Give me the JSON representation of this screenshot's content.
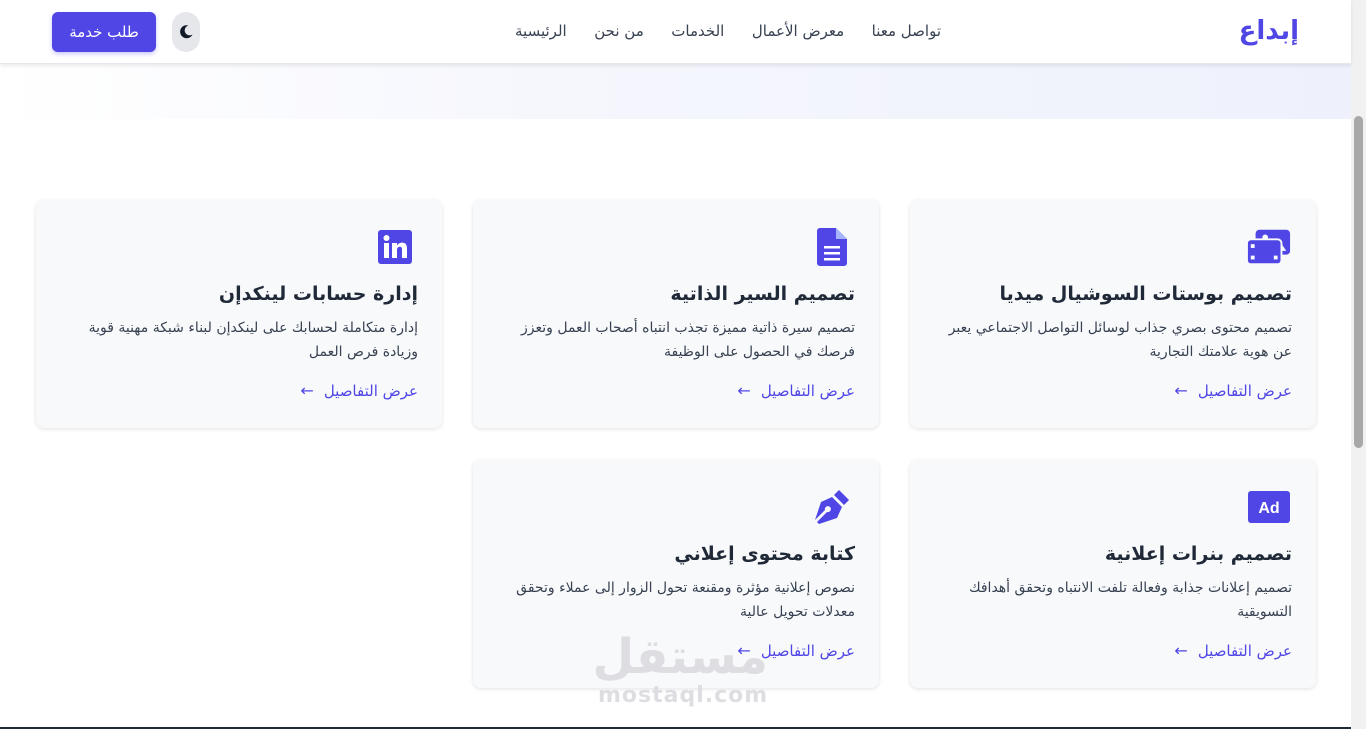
{
  "header": {
    "logo": "إبداع",
    "nav": [
      {
        "label": "الرئيسية"
      },
      {
        "label": "من نحن"
      },
      {
        "label": "الخدمات"
      },
      {
        "label": "معرض الأعمال"
      },
      {
        "label": "تواصل معنا"
      }
    ],
    "theme_toggle_icon": "moon-icon",
    "cta_label": "طلب خدمة"
  },
  "services": [
    {
      "icon": "photo-film-icon",
      "title": "تصميم بوستات السوشيال ميديا",
      "description": "تصميم محتوى بصري جذاب لوسائل التواصل الاجتماعي يعبر عن هوية علامتك التجارية",
      "link": "عرض التفاصيل"
    },
    {
      "icon": "file-icon",
      "title": "تصميم السير الذاتية",
      "description": "تصميم سيرة ذاتية مميزة تجذب انتباه أصحاب العمل وتعزز فرصك في الحصول على الوظيفة",
      "link": "عرض التفاصيل"
    },
    {
      "icon": "linkedin-icon",
      "title": "إدارة حسابات لينكدإن",
      "description": "إدارة متكاملة لحسابك على لينكدإن لبناء شبكة مهنية قوية وزيادة فرص العمل",
      "link": "عرض التفاصيل"
    },
    {
      "icon": "ad-icon",
      "title": "تصميم بنرات إعلانية",
      "description": "تصميم إعلانات جذابة وفعالة تلفت الانتباه وتحقق أهدافك التسويقية",
      "link": "عرض التفاصيل"
    },
    {
      "icon": "pen-nib-icon",
      "title": "كتابة محتوى إعلاني",
      "description": "نصوص إعلانية مؤثرة ومقنعة تحول الزوار إلى عملاء وتحقق معدلات تحويل عالية",
      "link": "عرض التفاصيل"
    }
  ],
  "watermark": {
    "arabic": "مستقل",
    "latin": "mostaql.com"
  },
  "colors": {
    "accent": "#4f46e5",
    "card_bg": "#f8f9fb",
    "text": "#1f2937"
  }
}
